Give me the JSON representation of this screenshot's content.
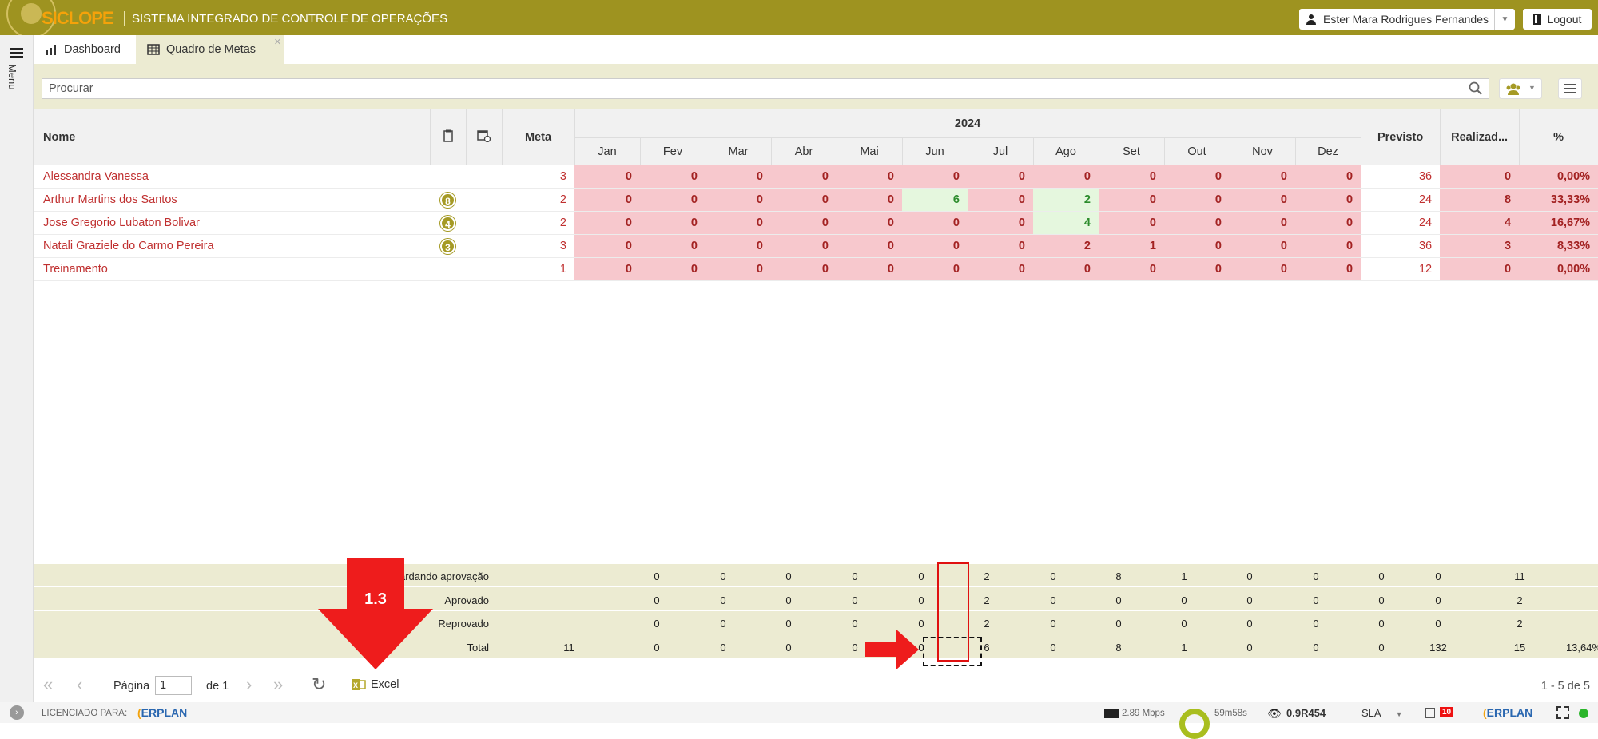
{
  "header": {
    "brand": "SICLOPE",
    "subtitle": "SISTEMA INTEGRADO DE CONTROLE DE OPERAÇÕES",
    "user": "Ester Mara Rodrigues Fernandes",
    "logout": "Logout",
    "color": "#9e9320"
  },
  "sidebar": {
    "menu_label": "Menu"
  },
  "tabs": [
    {
      "label": "Dashboard"
    },
    {
      "label": "Quadro de Metas"
    }
  ],
  "search": {
    "placeholder": "Procurar"
  },
  "grid": {
    "columns": {
      "name": "Nome",
      "meta": "Meta",
      "year": "2024",
      "previsto": "Previsto",
      "realizado": "Realizad...",
      "percent": "%"
    },
    "months": [
      "Jan",
      "Fev",
      "Mar",
      "Abr",
      "Mai",
      "Jun",
      "Jul",
      "Ago",
      "Set",
      "Out",
      "Nov",
      "Dez"
    ],
    "rows": [
      {
        "name": "Alessandra Vanessa",
        "badge": "",
        "meta": "3",
        "months": [
          "0",
          "0",
          "0",
          "0",
          "0",
          "0",
          "0",
          "0",
          "0",
          "0",
          "0",
          "0"
        ],
        "previsto": "36",
        "realizado": "0",
        "percent": "0,00%"
      },
      {
        "name": "Arthur Martins dos Santos",
        "badge": "8",
        "meta": "2",
        "months": [
          "0",
          "0",
          "0",
          "0",
          "0",
          "6",
          "0",
          "2",
          "0",
          "0",
          "0",
          "0"
        ],
        "previsto": "24",
        "realizado": "8",
        "percent": "33,33%"
      },
      {
        "name": "Jose Gregorio Lubaton Bolivar",
        "badge": "4",
        "meta": "2",
        "months": [
          "0",
          "0",
          "0",
          "0",
          "0",
          "0",
          "0",
          "4",
          "0",
          "0",
          "0",
          "0"
        ],
        "previsto": "24",
        "realizado": "4",
        "percent": "16,67%"
      },
      {
        "name": "Natali Graziele do Carmo Pereira",
        "badge": "3",
        "meta": "3",
        "months": [
          "0",
          "0",
          "0",
          "0",
          "0",
          "0",
          "0",
          "2",
          "1",
          "0",
          "0",
          "0"
        ],
        "previsto": "36",
        "realizado": "3",
        "percent": "8,33%"
      },
      {
        "name": "Treinamento",
        "badge": "",
        "meta": "1",
        "months": [
          "0",
          "0",
          "0",
          "0",
          "0",
          "0",
          "0",
          "0",
          "0",
          "0",
          "0",
          "0"
        ],
        "previsto": "12",
        "realizado": "0",
        "percent": "0,00%"
      }
    ]
  },
  "summary": [
    {
      "label": "Aguardando aprovação",
      "meta": "",
      "months": [
        "0",
        "0",
        "0",
        "0",
        "0",
        "2",
        "0",
        "8",
        "1",
        "0",
        "0",
        "0"
      ],
      "previsto": "0",
      "realizado": "11",
      "percent": ""
    },
    {
      "label": "Aprovado",
      "meta": "",
      "months": [
        "0",
        "0",
        "0",
        "0",
        "0",
        "2",
        "0",
        "0",
        "0",
        "0",
        "0",
        "0"
      ],
      "previsto": "0",
      "realizado": "2",
      "percent": ""
    },
    {
      "label": "Reprovado",
      "meta": "",
      "months": [
        "0",
        "0",
        "0",
        "0",
        "0",
        "2",
        "0",
        "0",
        "0",
        "0",
        "0",
        "0"
      ],
      "previsto": "0",
      "realizado": "2",
      "percent": ""
    },
    {
      "label": "Total",
      "meta": "11",
      "months": [
        "0",
        "0",
        "0",
        "0",
        "0",
        "6",
        "0",
        "8",
        "1",
        "0",
        "0",
        "0"
      ],
      "previsto": "132",
      "realizado": "15",
      "percent": "13,64%"
    }
  ],
  "annotation": {
    "step": "1.3"
  },
  "pager": {
    "page_label": "Página",
    "page_value": "1",
    "of_label": "de 1",
    "excel": "Excel",
    "range": "1 - 5 de 5"
  },
  "footer": {
    "licensed": "LICENCIADO PARA:",
    "brand": "ERPLAN",
    "speed": "2.89 Mbps",
    "timer": "59m58s",
    "version": "0.9R454",
    "sla": "SLA",
    "notif": "10"
  }
}
